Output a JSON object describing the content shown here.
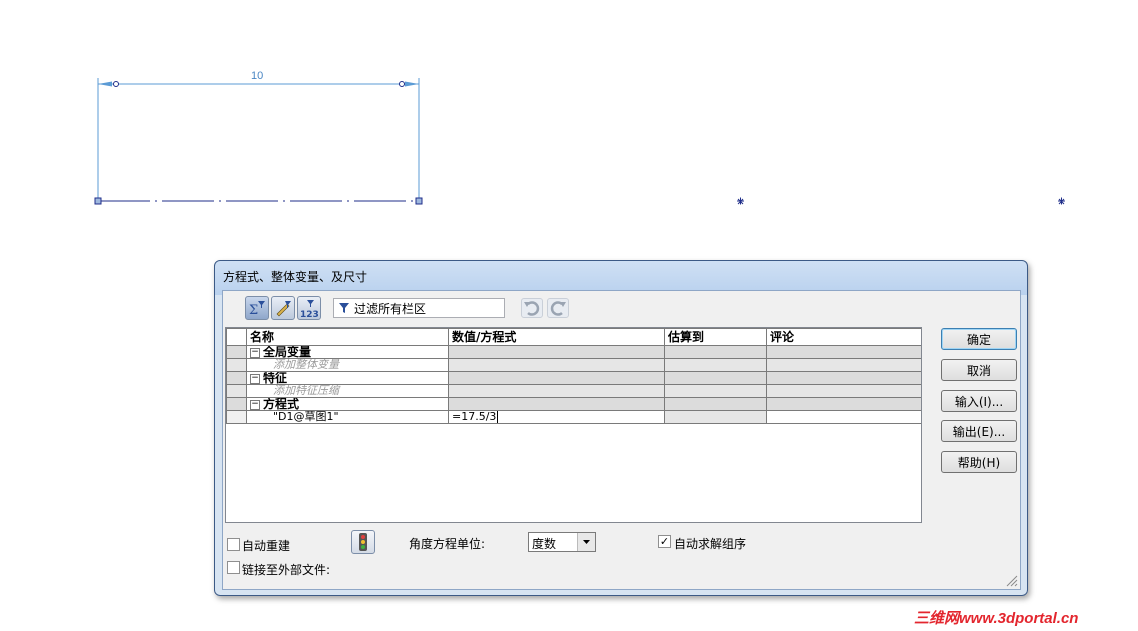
{
  "sketch": {
    "dimension_label": "10"
  },
  "dialog": {
    "title": "方程式、整体变量、及尺寸",
    "filter_text": "过滤所有栏区",
    "columns": [
      "名称",
      "数值/方程式",
      "估算到",
      "评论"
    ],
    "sections": {
      "globals": {
        "label": "全局变量",
        "hint": "添加整体变量"
      },
      "features": {
        "label": "特征",
        "hint": "添加特征压缩"
      },
      "equations": {
        "label": "方程式"
      }
    },
    "equation_row": {
      "name": "\"D1@草图1\"",
      "value": "=17.5/3",
      "evaluates_to": "",
      "comment": ""
    },
    "buttons": {
      "ok": "确定",
      "cancel": "取消",
      "import": "输入(I)...",
      "export": "输出(E)...",
      "help": "帮助(H)"
    },
    "auto_rebuild": {
      "label": "自动重建",
      "checked": false
    },
    "link_external": {
      "label": "链接至外部文件:",
      "checked": false
    },
    "angle_units": {
      "label": "角度方程单位:",
      "value": "度数"
    },
    "auto_solve": {
      "label": "自动求解组序",
      "checked": true
    }
  },
  "watermark": "三维网www.3dportal.cn",
  "colors": {
    "sketch_line": "#5b9bd5",
    "construction_line": "#1f2d8a",
    "dialog_border": "#3c5a86",
    "watermark": "#e3262e"
  }
}
